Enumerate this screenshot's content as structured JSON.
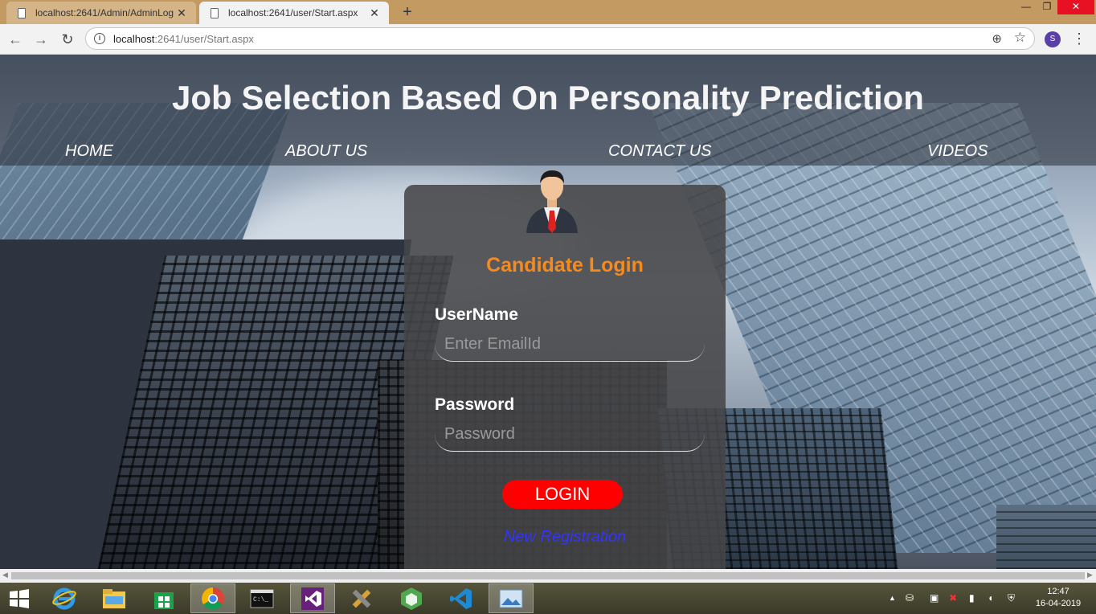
{
  "browser": {
    "tabs": [
      {
        "title": "localhost:2641/Admin/AdminLog",
        "close": "✕"
      },
      {
        "title": "localhost:2641/user/Start.aspx",
        "close": "✕"
      }
    ],
    "new_tab": "+",
    "url_host": "localhost",
    "url_rest": ":2641/user/Start.aspx",
    "profile_initial": "S",
    "back": "←",
    "forward": "→",
    "reload": "↻",
    "zoom": "⊕",
    "star": "☆",
    "menu": "⋮",
    "window": {
      "minimize": "—",
      "restore": "❐",
      "close": "✕"
    }
  },
  "page": {
    "title": "Job Selection Based On Personality Prediction",
    "nav": [
      "HOME",
      "ABOUT US",
      "CONTACT US",
      "VIDEOS"
    ],
    "login": {
      "heading": "Candidate Login",
      "username_label": "UserName",
      "username_placeholder": "Enter EmailId",
      "password_label": "Password",
      "password_placeholder": "Password",
      "login_button": "LOGIN",
      "register_link": "New Registration"
    }
  },
  "taskbar": {
    "time": "12:47",
    "date": "16-04-2019"
  },
  "colors": {
    "heading_orange": "#f58a1f",
    "login_red": "#ff0000",
    "link_blue": "#3333ff"
  }
}
